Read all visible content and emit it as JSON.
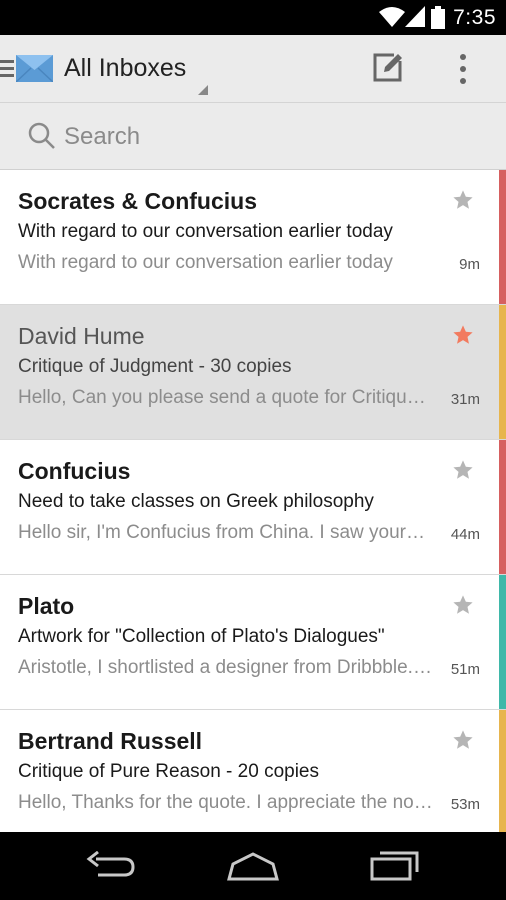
{
  "status_bar": {
    "time": "7:35"
  },
  "app_bar": {
    "title": "All Inboxes",
    "icons": {
      "menu": "menu-icon",
      "app": "envelope-icon",
      "compose": "compose-icon",
      "overflow": "overflow-menu-icon"
    }
  },
  "search": {
    "placeholder": "Search"
  },
  "colors": {
    "red": "#d66060",
    "orange": "#e7b54e",
    "teal": "#3fb8a9",
    "star_active": "#f27b5f",
    "star_inactive": "#b5b5b5"
  },
  "emails": [
    {
      "sender": "Socrates & Confucius",
      "subject": "With regard to our conversation earlier today",
      "preview": "With regard to our conversation earlier today",
      "time": "9m",
      "starred": false,
      "accent": "#d66060",
      "read": false,
      "selected": false
    },
    {
      "sender": "David Hume",
      "subject": "Critique of Judgment - 30 copies",
      "preview": "Hello, Can you please send a quote for Critique…",
      "time": "31m",
      "starred": true,
      "accent": "#e7b54e",
      "read": true,
      "selected": true
    },
    {
      "sender": "Confucius",
      "subject": "Need to take classes on Greek philosophy",
      "preview": "Hello sir, I'm Confucius from China. I saw your…",
      "time": "44m",
      "starred": false,
      "accent": "#d66060",
      "read": false,
      "selected": false
    },
    {
      "sender": "Plato",
      "subject": "Artwork for \"Collection of Plato's Dialogues\"",
      "preview": "Aristotle, I shortlisted a designer from Dribbble.…",
      "time": "51m",
      "starred": false,
      "accent": "#3fb8a9",
      "read": false,
      "selected": false
    },
    {
      "sender": "Bertrand Russell",
      "subject": "Critique of Pure Reason - 20 copies",
      "preview": "Hello, Thanks for the quote. I appreciate the no…",
      "time": "53m",
      "starred": false,
      "accent": "#e7b54e",
      "read": false,
      "selected": false
    }
  ],
  "nav_bar": {
    "icons": [
      "back-icon",
      "home-icon",
      "recents-icon"
    ]
  }
}
